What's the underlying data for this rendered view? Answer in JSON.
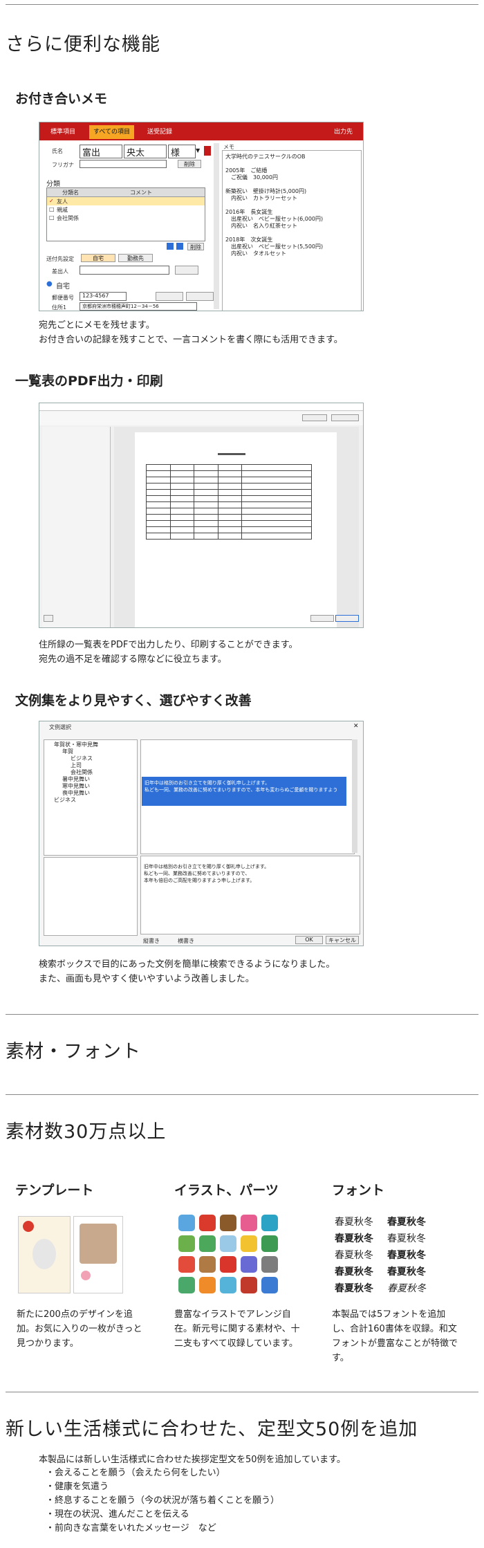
{
  "sections": {
    "convenient": "さらに便利な機能",
    "materials": "素材・フォント",
    "materials_count": "素材数30万点以上",
    "new_phrases": "新しい生活様式に合わせた、定型文50例を追加"
  },
  "memo": {
    "heading": "お付き合いメモ",
    "caption1": "宛先ごとにメモを残せます。",
    "caption2": "お付き合いの記録を残すことで、一言コメントを書く際にも活用できます。",
    "ui": {
      "tabs": [
        "標準項目",
        "すべての項目",
        "送受記録"
      ],
      "print_label": "出力先",
      "name_label": "氏名",
      "furigana_label": "フリガナ",
      "last_name": "富出",
      "first_name": "央太",
      "honorific": "様",
      "delete": "削除",
      "category_label": "分類",
      "category_col": "分類名",
      "comment_col": "コメント",
      "categories": [
        "友人",
        "親戚",
        "会社関係"
      ],
      "send_label": "送付先設定",
      "home": "自宅",
      "work": "勤務先",
      "sender_label": "差出人",
      "home_section": "自宅",
      "postal_label": "郵便番号",
      "postal": "123-4567",
      "address_label": "住所1",
      "address": "京都府栄洲市穂穂声町12－34－56",
      "memo_label": "メモ",
      "memo_text": "大学時代のテニスサークルのOB\n\n2005年　ご結婚\n　ご祝儀　30,000円\n\n新築祝い　壁掛け時計(5,000円)\n　内祝い　カトラリーセット\n\n2016年　長女誕生\n　出産祝い　ベビー服セット(6,000円)\n　内祝い　名入り紅茶セット\n\n2018年　次女誕生\n　出産祝い　ベビー服セット(5,500円)\n　内祝い　タオルセット"
    }
  },
  "pdf": {
    "heading": "一覧表のPDF出力・印刷",
    "caption1": "住所録の一覧表をPDFで出力したり、印刷することができます。",
    "caption2": "宛先の過不足を確認する際などに役立ちます。"
  },
  "phrases": {
    "heading": "文例集をより見やすく、選びやすく改善",
    "caption1": "検索ボックスで目的にあった文例を簡単に検索できるようになりました。",
    "caption2": "また、画面も見やすく使いやすいよう改善しました。",
    "ui": {
      "title": "文例選択",
      "tree": [
        "年賀状・寒中見舞",
        "年賀",
        "ビジネス",
        "上司",
        "会社関係",
        "暑中見舞い",
        "寒中見舞い",
        "喪中見舞い",
        "ビジネス"
      ],
      "ok": "OK",
      "cancel": "キャンセル",
      "radio1": "縦書き",
      "radio2": "横書き",
      "selected_text": "旧年中は格別のお引き立てを賜り厚く御礼申し上げます。\n私ども一同、業務の改善に努めてまいりますので、本年も変わらぬご愛顧を賜りますよう",
      "preview_text": "旧年中は格別のお引き立てを賜り厚く御礼申し上げます。\n私ども一同、業務改善に努めてまいりますので、\n本年も倍旧のご高配を賜りますよう申し上げます。"
    }
  },
  "columns": [
    {
      "title": "テンプレート",
      "text": "新たに200点のデザインを追加。お気に入りの一枚がきっと見つかります。"
    },
    {
      "title": "イラスト、パーツ",
      "text": "豊富なイラストでアレンジ自在。新元号に関する素材や、十二支もすべて収録しています。"
    },
    {
      "title": "フォント",
      "text": "本製品では5フォントを追加し、合計160書体を収録。和文フォントが豊富なことが特徴です。"
    }
  ],
  "fonts_sample": [
    "春夏秋冬",
    "春夏秋冬",
    "春夏秋冬",
    "春夏秋冬",
    "春夏秋冬",
    "春夏秋冬",
    "春夏秋冬",
    "春夏秋冬",
    "春夏秋冬",
    "春夏秋冬"
  ],
  "new_phrases_intro": "本製品には新しい生活様式に合わせた挨拶定型文を50例を追加しています。",
  "new_phrases_list": [
    "・会えることを願う（会えたら何をしたい）",
    "・健康を気遣う",
    "・終息することを願う（今の状況が落ち着くことを願う）",
    "・現在の状況、進んだことを伝える",
    "・前向きな言葉をいれたメッセージ　など"
  ]
}
